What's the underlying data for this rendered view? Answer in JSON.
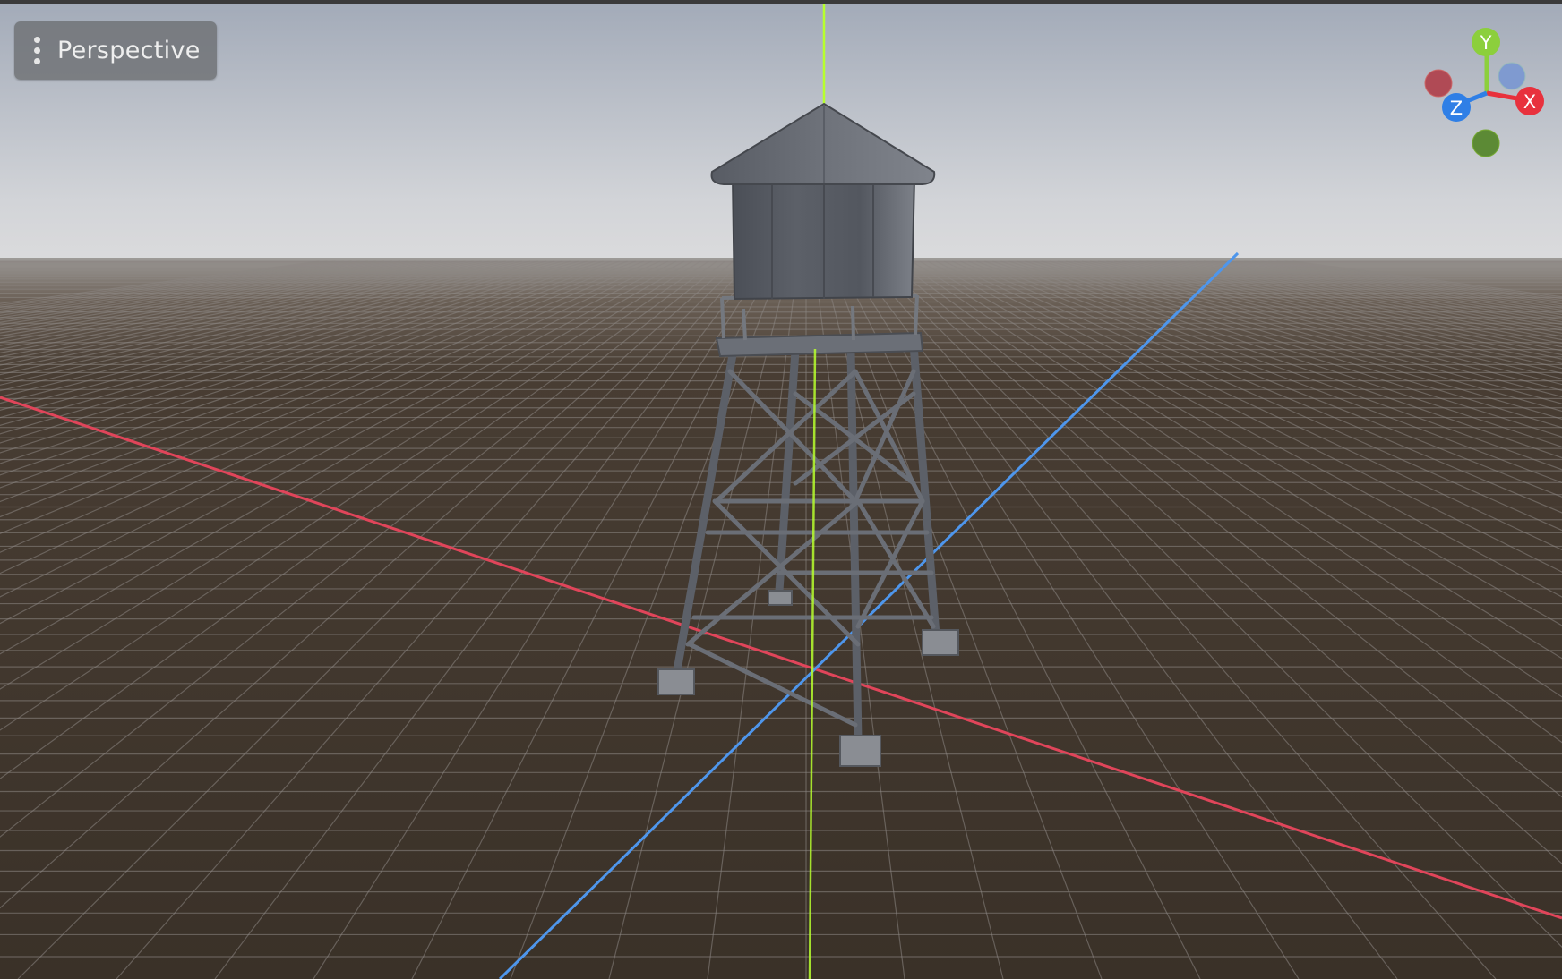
{
  "scene_view": {
    "view_mode_label": "Perspective",
    "menu_icon": "kebab-menu-icon"
  },
  "orientation_gizmo": {
    "labels": {
      "y": "Y",
      "x": "X",
      "z": "Z"
    },
    "colors": {
      "x": "#e8313d",
      "y": "#8ccf3c",
      "z": "#2f7fe6"
    }
  },
  "colors": {
    "sky_top": "#a6adba",
    "sky_horizon": "#d8d9dc",
    "ground": "#3a3128",
    "grid_line": "#8c8784",
    "x_axis": "#e0455a",
    "y_axis": "#b7ff2e",
    "z_axis": "#4e96ec",
    "model": "#5c6068"
  },
  "model_name": "water-tower"
}
